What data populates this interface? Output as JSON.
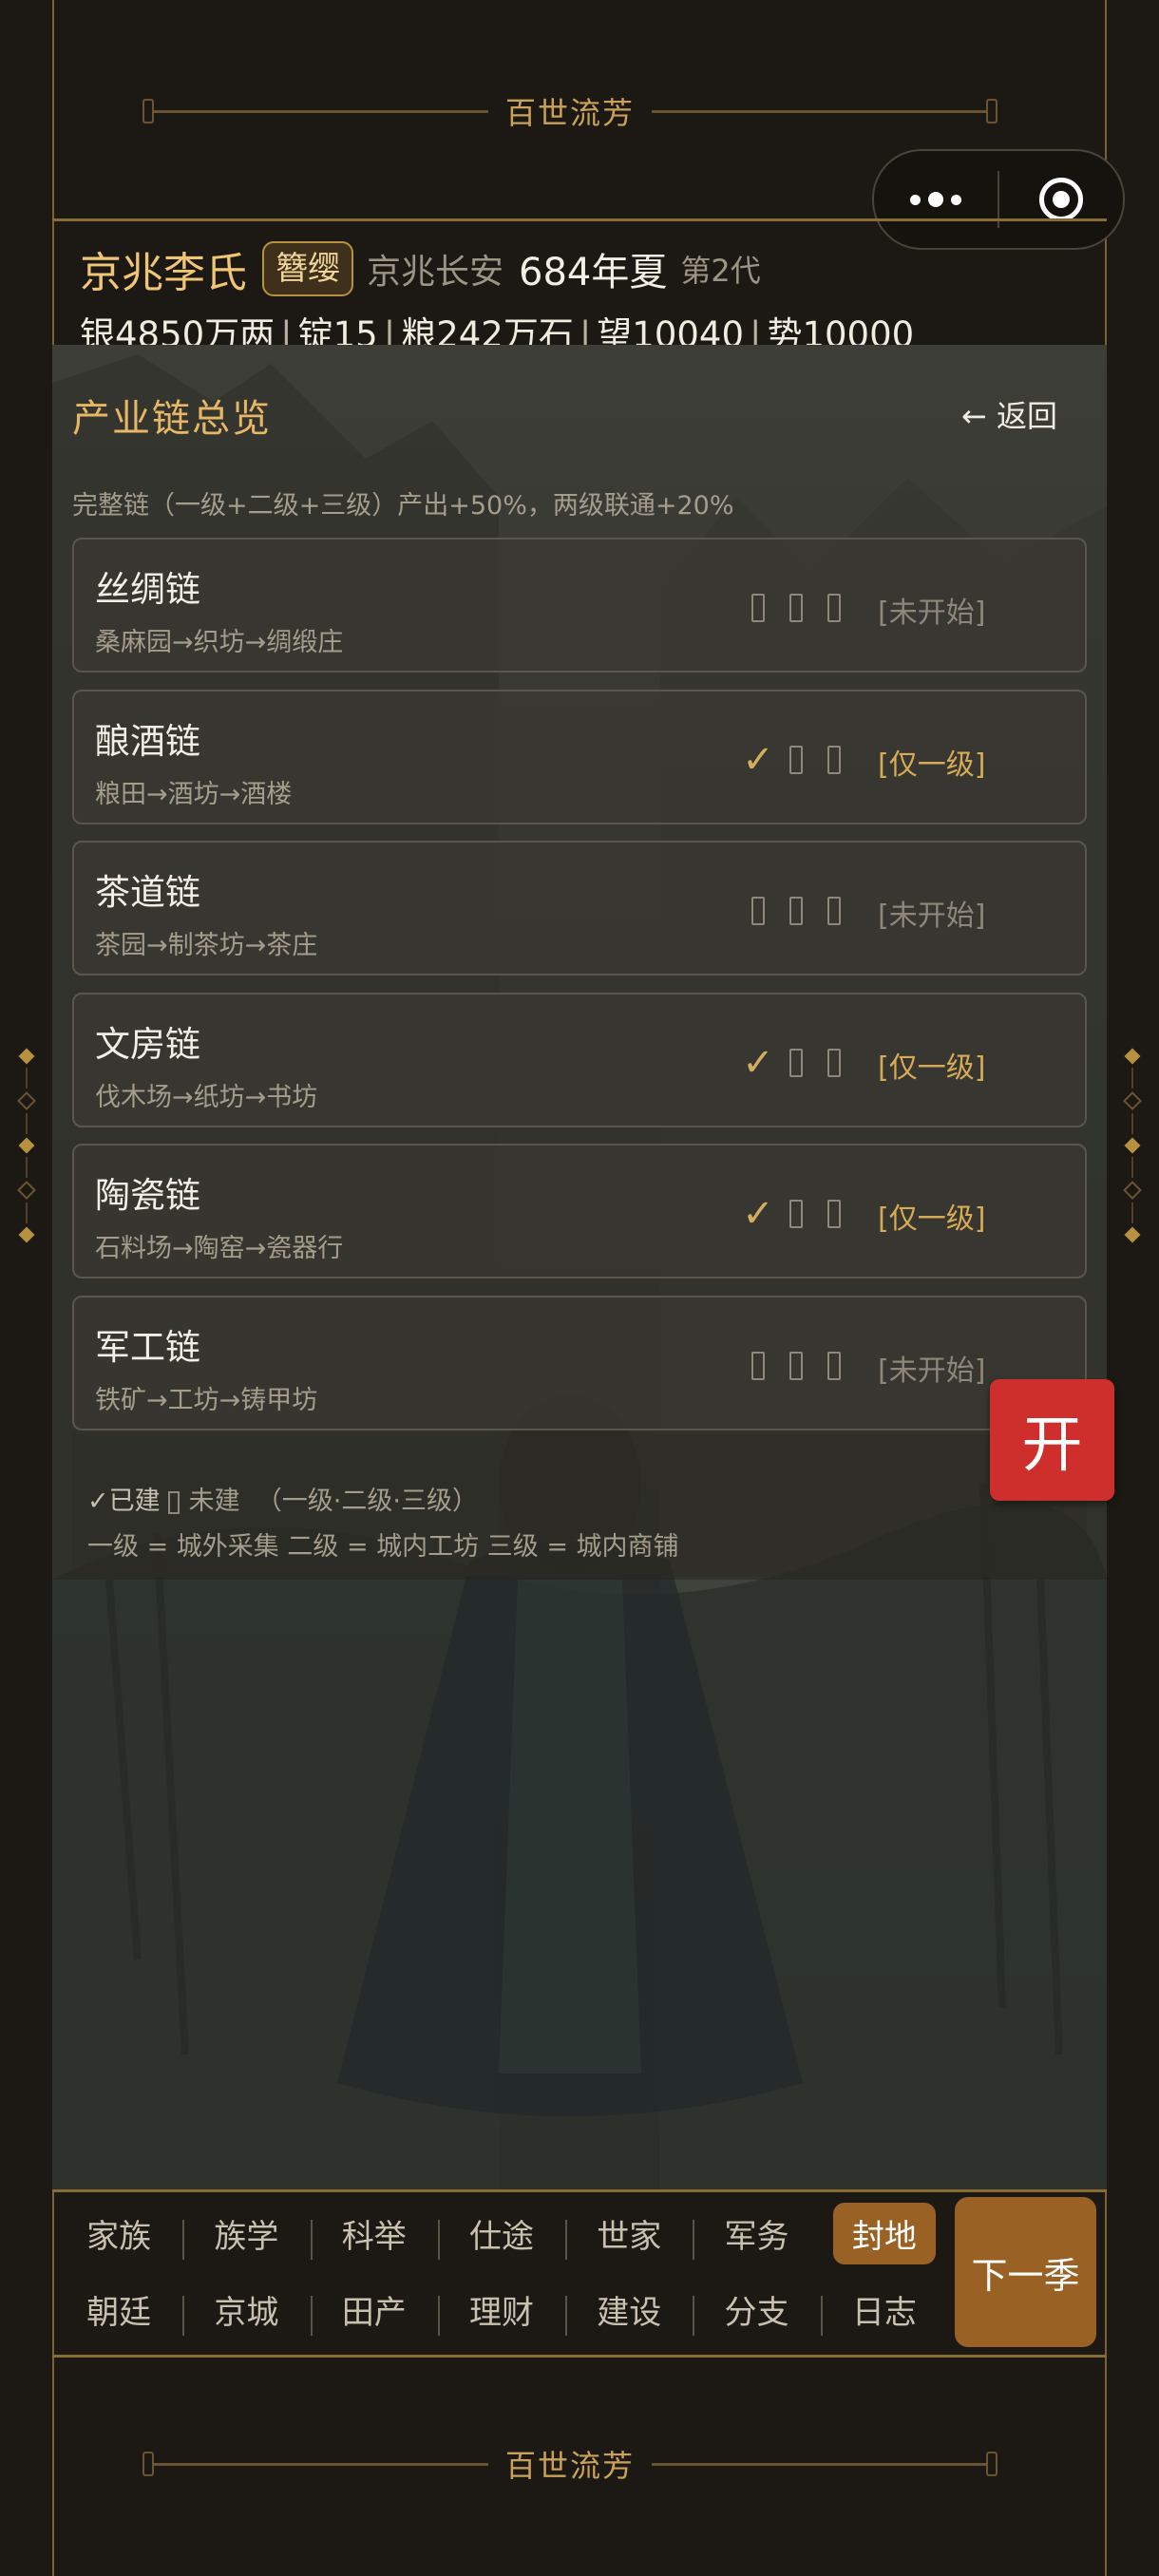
{
  "banner": {
    "title": "百世流芳"
  },
  "header": {
    "clan_name": "京兆李氏",
    "rank": "簪缨",
    "place": "京兆长安",
    "year_season": "684年夏",
    "generation": "第2代",
    "resources": [
      {
        "label": "银4850万两"
      },
      {
        "label": "锭15"
      },
      {
        "label": "粮242万石"
      },
      {
        "label": "望10040"
      },
      {
        "label": "势10000"
      }
    ]
  },
  "panel": {
    "title": "产业链总览",
    "back_label": "← 返回",
    "note": "完整链（一级+二级+三级）产出+50%，两级联通+20%",
    "chains": [
      {
        "name": "丝绸链",
        "path": "桑麻园→织坊→绸缎庄",
        "marks": [
          "none",
          "none",
          "none"
        ],
        "status": "[未开始]"
      },
      {
        "name": "酿酒链",
        "path": "粮田→酒坊→酒楼",
        "marks": [
          "done",
          "none",
          "none"
        ],
        "status": "[仅一级]"
      },
      {
        "name": "茶道链",
        "path": "茶园→制茶坊→茶庄",
        "marks": [
          "none",
          "none",
          "none"
        ],
        "status": "[未开始]"
      },
      {
        "name": "文房链",
        "path": "伐木场→纸坊→书坊",
        "marks": [
          "done",
          "none",
          "none"
        ],
        "status": "[仅一级]"
      },
      {
        "name": "陶瓷链",
        "path": "石料场→陶窑→瓷器行",
        "marks": [
          "done",
          "none",
          "none"
        ],
        "status": "[仅一级]"
      },
      {
        "name": "军工链",
        "path": "铁矿→工坊→铸甲坊",
        "marks": [
          "none",
          "none",
          "none"
        ],
        "status": "[未开始]"
      }
    ],
    "legend": {
      "built": "✓已建",
      "unbuilt": "未建",
      "levels": "（一级·二级·三级）",
      "explain": "一级 = 城外采集  二级 = 城内工坊  三级 = 城内商铺"
    }
  },
  "open_button": "开",
  "nav": {
    "row1": [
      "家族",
      "族学",
      "科举",
      "仕途",
      "世家",
      "军务",
      "封地"
    ],
    "row2": [
      "朝廷",
      "京城",
      "田产",
      "理财",
      "建设",
      "分支",
      "日志"
    ],
    "active": "封地",
    "next_label": "下一季"
  },
  "colors": {
    "accent_gold": "#e7b765",
    "nav_active": "#9a6124",
    "open_red": "#cf2f2c"
  },
  "icons": {
    "menu": "more-dots-icon",
    "target": "target-icon",
    "check": "check-icon"
  }
}
